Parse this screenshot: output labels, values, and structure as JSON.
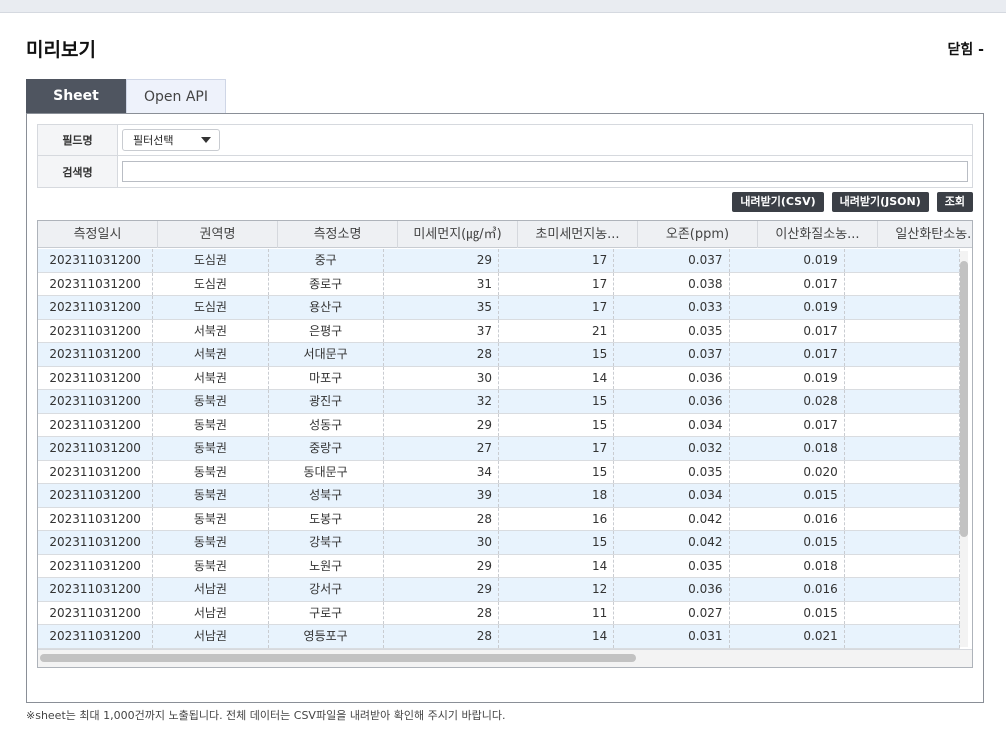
{
  "modal": {
    "title": "미리보기",
    "close_label": "닫힘 -"
  },
  "tabs": [
    {
      "label": "Sheet",
      "active": true
    },
    {
      "label": "Open API",
      "active": false
    }
  ],
  "filter": {
    "field_label": "필드명",
    "field_select_value": "필터선택",
    "search_label": "검색명",
    "search_value": ""
  },
  "buttons": {
    "download_csv": "내려받기(CSV)",
    "download_json": "내려받기(JSON)",
    "query": "조회"
  },
  "grid": {
    "columns": [
      "측정일시",
      "권역명",
      "측정소명",
      "미세먼지(㎍/㎥)",
      "초미세먼지농...",
      "오존(ppm)",
      "이산화질소농...",
      "일산화탄소농..."
    ],
    "rows": [
      [
        "202311031200",
        "도심권",
        "중구",
        "29",
        "17",
        "0.037",
        "0.019",
        ""
      ],
      [
        "202311031200",
        "도심권",
        "종로구",
        "31",
        "17",
        "0.038",
        "0.017",
        ""
      ],
      [
        "202311031200",
        "도심권",
        "용산구",
        "35",
        "17",
        "0.033",
        "0.019",
        ""
      ],
      [
        "202311031200",
        "서북권",
        "은평구",
        "37",
        "21",
        "0.035",
        "0.017",
        ""
      ],
      [
        "202311031200",
        "서북권",
        "서대문구",
        "28",
        "15",
        "0.037",
        "0.017",
        ""
      ],
      [
        "202311031200",
        "서북권",
        "마포구",
        "30",
        "14",
        "0.036",
        "0.019",
        ""
      ],
      [
        "202311031200",
        "동북권",
        "광진구",
        "32",
        "15",
        "0.036",
        "0.028",
        ""
      ],
      [
        "202311031200",
        "동북권",
        "성동구",
        "29",
        "15",
        "0.034",
        "0.017",
        ""
      ],
      [
        "202311031200",
        "동북권",
        "중랑구",
        "27",
        "17",
        "0.032",
        "0.018",
        ""
      ],
      [
        "202311031200",
        "동북권",
        "동대문구",
        "34",
        "15",
        "0.035",
        "0.020",
        ""
      ],
      [
        "202311031200",
        "동북권",
        "성북구",
        "39",
        "18",
        "0.034",
        "0.015",
        ""
      ],
      [
        "202311031200",
        "동북권",
        "도봉구",
        "28",
        "16",
        "0.042",
        "0.016",
        ""
      ],
      [
        "202311031200",
        "동북권",
        "강북구",
        "30",
        "15",
        "0.042",
        "0.015",
        ""
      ],
      [
        "202311031200",
        "동북권",
        "노원구",
        "29",
        "14",
        "0.035",
        "0.018",
        ""
      ],
      [
        "202311031200",
        "서남권",
        "강서구",
        "29",
        "12",
        "0.036",
        "0.016",
        ""
      ],
      [
        "202311031200",
        "서남권",
        "구로구",
        "28",
        "11",
        "0.027",
        "0.015",
        ""
      ],
      [
        "202311031200",
        "서남권",
        "영등포구",
        "28",
        "14",
        "0.031",
        "0.021",
        ""
      ]
    ]
  },
  "footnote": "※sheet는 최대 1,000건까지 노출됩니다. 전체 데이터는 CSV파일을 내려받아 확인해 주시기 바랍니다.",
  "colors": {
    "active_tab": "#4f5560",
    "button_bg": "#3b3f46",
    "odd_row": "#e8f3fd"
  }
}
